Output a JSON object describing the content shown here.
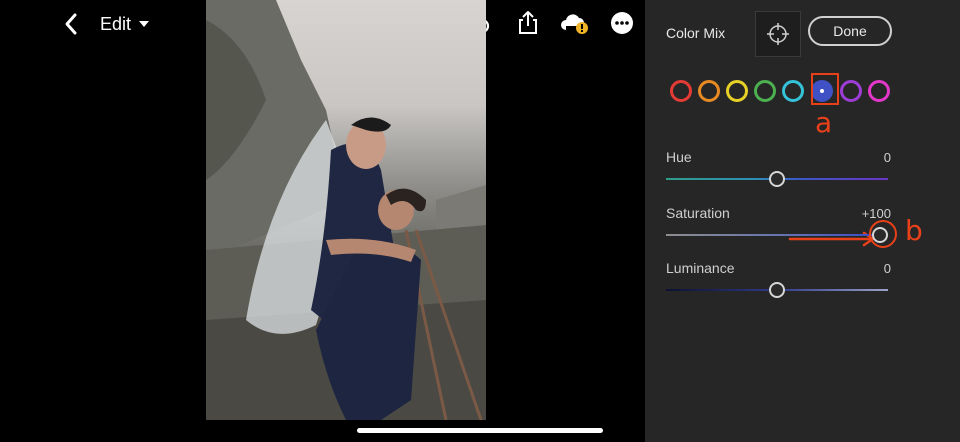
{
  "header": {
    "edit_label": "Edit"
  },
  "toolbar": {
    "icons": [
      "back-icon",
      "undo-icon",
      "share-icon",
      "cloud-sync-warning-icon",
      "more-icon"
    ]
  },
  "panel": {
    "title": "Color Mix",
    "done_label": "Done",
    "swatches": [
      {
        "name": "red",
        "color": "#e53b35"
      },
      {
        "name": "orange",
        "color": "#e88a24"
      },
      {
        "name": "yellow",
        "color": "#e7d126"
      },
      {
        "name": "green",
        "color": "#4caf50"
      },
      {
        "name": "aqua",
        "color": "#35c1d8"
      },
      {
        "name": "blue",
        "color": "#3f51c4",
        "selected": true
      },
      {
        "name": "purple",
        "color": "#9c3ed6"
      },
      {
        "name": "magenta",
        "color": "#e337c9"
      }
    ],
    "sliders": [
      {
        "label": "Hue",
        "value": "0",
        "level": 0.5
      },
      {
        "label": "Saturation",
        "value": "+100",
        "level": 1.0
      },
      {
        "label": "Luminance",
        "value": "0",
        "level": 0.5
      }
    ]
  },
  "annotations": {
    "swatch_mark": "a",
    "slider_mark": "b",
    "color": "#e8411a"
  }
}
